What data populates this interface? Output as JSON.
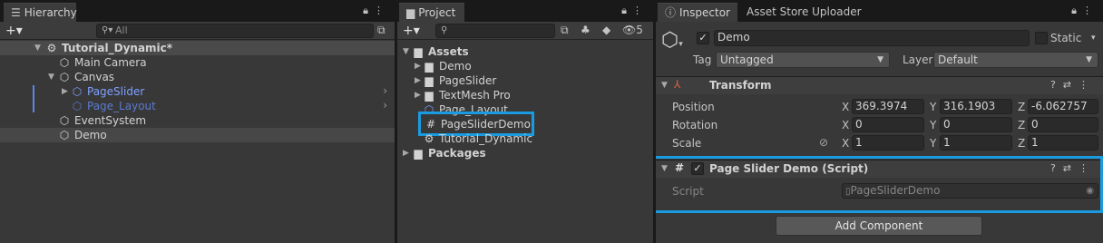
{
  "hierarchy": {
    "tab_label": "Hierarchy",
    "search_placeholder": "All",
    "scene_name": "Tutorial_Dynamic*",
    "items": [
      "Main Camera",
      "Canvas",
      "PageSlider",
      "Page_Layout",
      "EventSystem",
      "Demo"
    ]
  },
  "project": {
    "tab_label": "Project",
    "hidden_count": "5",
    "assets_label": "Assets",
    "items": [
      "Demo",
      "PageSlider",
      "TextMesh Pro",
      "Page_Layout",
      "PageSliderDemo",
      "Tutorial_Dynamic"
    ],
    "packages_label": "Packages"
  },
  "inspector": {
    "tab_label": "Inspector",
    "tab2_label": "Asset Store Uploader",
    "object_name": "Demo",
    "static_label": "Static",
    "tag_label": "Tag",
    "tag_value": "Untagged",
    "layer_label": "Layer",
    "layer_value": "Default",
    "transform": {
      "title": "Transform",
      "position_label": "Position",
      "rotation_label": "Rotation",
      "scale_label": "Scale",
      "x": "X",
      "y": "Y",
      "z": "Z",
      "position": [
        "369.3974",
        "316.1903",
        "-6.062757"
      ],
      "rotation": [
        "0",
        "0",
        "0"
      ],
      "scale": [
        "1",
        "1",
        "1"
      ]
    },
    "script_component": {
      "title": "Page Slider Demo (Script)",
      "script_label": "Script",
      "script_value": "PageSliderDemo"
    },
    "add_component_label": "Add Component"
  },
  "colors": {
    "highlight": "#1a9be0",
    "selected_text": "#7ea0ff"
  }
}
